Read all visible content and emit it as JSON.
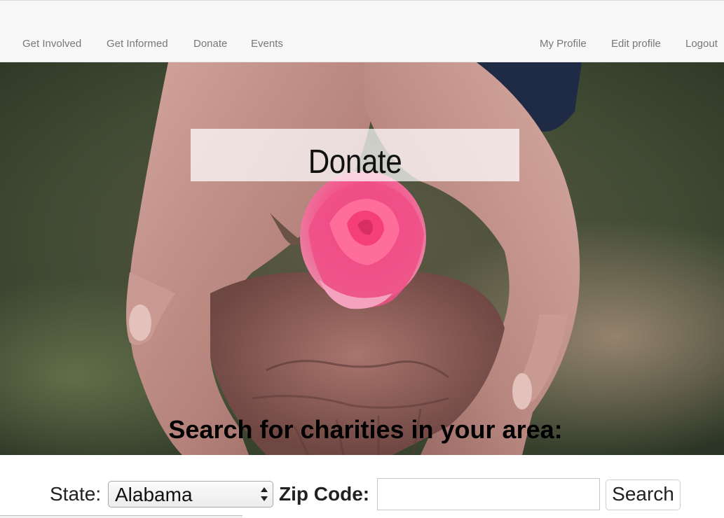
{
  "nav": {
    "left_items": [
      {
        "label": "Get Involved"
      },
      {
        "label": "Get Informed"
      },
      {
        "label": "Donate"
      },
      {
        "label": "Events"
      }
    ],
    "right_items": [
      {
        "label": "My Profile"
      },
      {
        "label": "Edit profile"
      },
      {
        "label": "Logout"
      }
    ]
  },
  "hero": {
    "title": "Donate",
    "search_heading": "Search for charities in your area:"
  },
  "form": {
    "state_label": "State:",
    "state_value": "Alabama",
    "zip_label": "Zip Code:",
    "zip_value": "",
    "search_button_label": "Search"
  },
  "colors": {
    "navbar_bg": "#f8f8f8",
    "nav_text": "#777777",
    "rose": "#f0508a",
    "skin": "#c99a92"
  }
}
